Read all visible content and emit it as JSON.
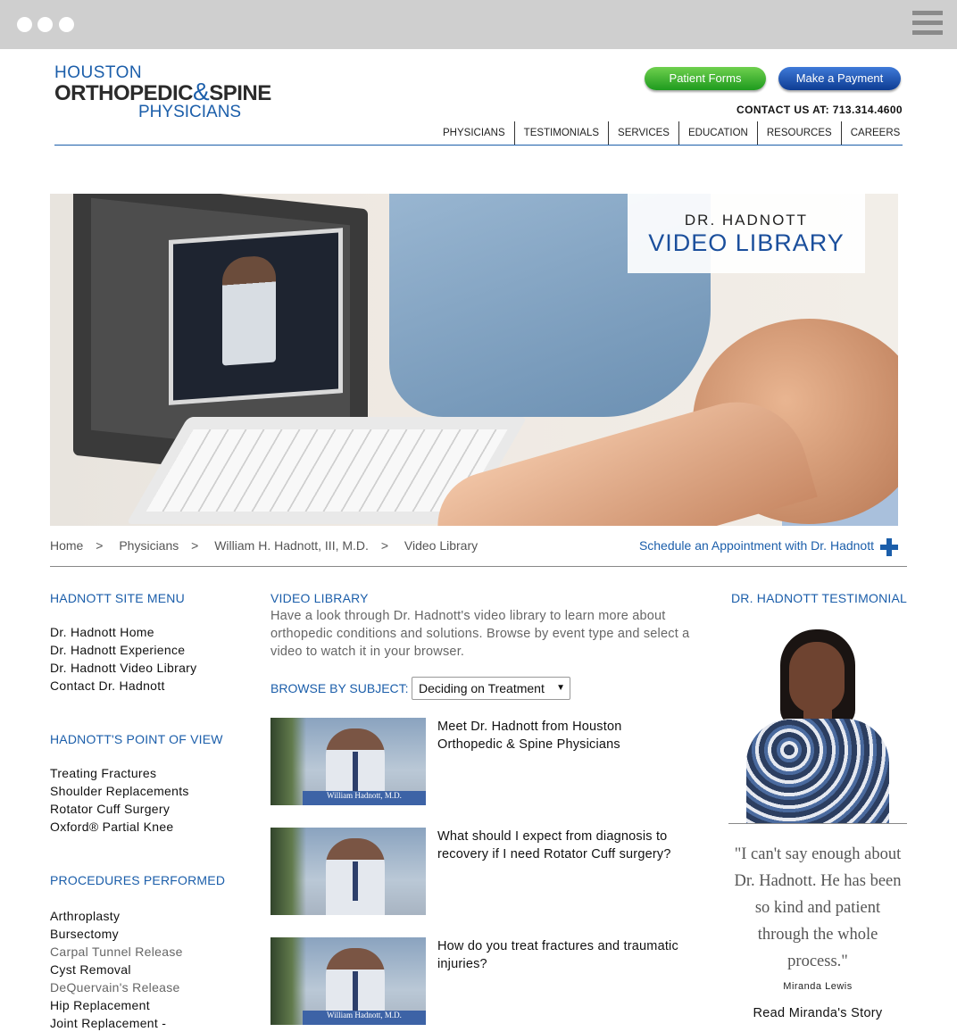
{
  "logo": {
    "line1": "HOUSTON",
    "line2_a": "ORTHOPEDIC",
    "line2_amp": "&",
    "line2_b": "SPINE",
    "line3": "PHYSICIANS"
  },
  "header": {
    "patient_forms": "Patient Forms",
    "make_payment": "Make a Payment",
    "contact": "CONTACT US AT: 713.314.4600"
  },
  "nav": [
    "PHYSICIANS",
    "TESTIMONIALS",
    "SERVICES",
    "EDUCATION",
    "RESOURCES",
    "CAREERS"
  ],
  "hero": {
    "title_small": "DR. HADNOTT",
    "title_large": "VIDEO LIBRARY",
    "video_caption": "William Hadnott, M.D."
  },
  "breadcrumb": [
    "Home",
    "Physicians",
    "William H. Hadnott, III, M.D.",
    "Video Library"
  ],
  "breadcrumb_sep": ">",
  "schedule_link": "Schedule an Appointment with Dr. Hadnott",
  "site_menu": {
    "heading": "HADNOTT SITE MENU",
    "items": [
      "Dr. Hadnott Home",
      "Dr. Hadnott Experience",
      "Dr. Hadnott Video Library",
      "Contact Dr. Hadnott"
    ]
  },
  "point_of_view": {
    "heading": "HADNOTT'S POINT OF VIEW",
    "items": [
      "Treating Fractures",
      "Shoulder Replacements",
      "Rotator Cuff Surgery",
      "Oxford® Partial Knee"
    ]
  },
  "procedures": {
    "heading": "PROCEDURES PERFORMED",
    "items": [
      "Arthroplasty",
      "Bursectomy",
      "Carpal Tunnel Release",
      "Cyst Removal",
      "DeQuervain's Release",
      "Hip Replacement",
      "Joint Replacement -"
    ]
  },
  "video_library": {
    "heading": "VIDEO LIBRARY",
    "intro": "Have a look through Dr. Hadnott's video library to learn more about orthopedic conditions and solutions. Browse by event type and select a video to watch it in your browser.",
    "browse_label": "BROWSE BY SUBJECT:",
    "browse_value": "Deciding on Treatment",
    "videos": [
      {
        "title": "Meet Dr. Hadnott from Houston Orthopedic & Spine Physicians",
        "caption": "William Hadnott, M.D."
      },
      {
        "title": "What should I expect from diagnosis to recovery if I need Rotator Cuff surgery?",
        "caption": ""
      },
      {
        "title": "How do you treat fractures and traumatic injuries?",
        "caption": "William Hadnott, M.D."
      }
    ]
  },
  "testimonial": {
    "heading": "DR. HADNOTT TESTIMONIAL",
    "quote": "\"I can't say enough about Dr. Hadnott. He has been so kind and patient through the whole process.\"",
    "author": "Miranda Lewis",
    "read_more": "Read Miranda's Story"
  },
  "colors": {
    "brand_blue": "#1b5eaa",
    "green_button": "#2aa52a",
    "blue_button": "#0d3c93"
  }
}
